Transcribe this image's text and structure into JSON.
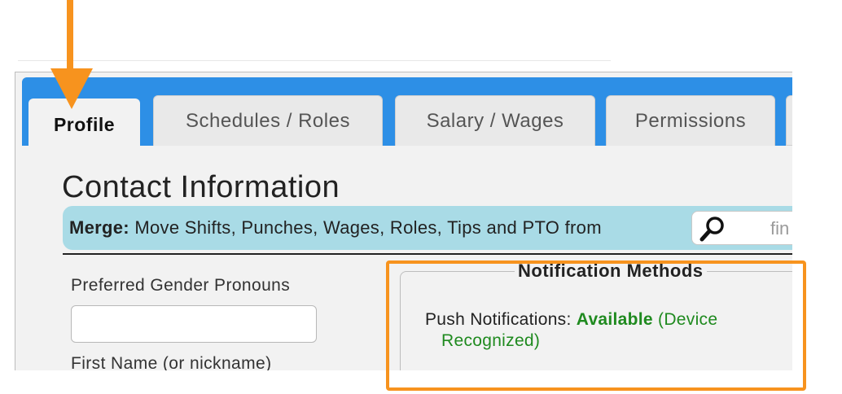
{
  "tabs": [
    {
      "label": "Profile",
      "active": true
    },
    {
      "label": "Schedules / Roles",
      "active": false
    },
    {
      "label": "Salary / Wages",
      "active": false
    },
    {
      "label": "Permissions",
      "active": false
    }
  ],
  "section_title": "Contact Information",
  "merge": {
    "bold_label": "Merge:",
    "text": "Move Shifts, Punches, Wages, Roles, Tips and PTO from",
    "search_placeholder": "fin"
  },
  "fields": {
    "pronouns_label": "Preferred Gender Pronouns",
    "pronouns_value": "",
    "first_name_label": "First Name (or nickname)"
  },
  "notifications": {
    "legend": "Notification Methods",
    "push_label": "Push Notifications:",
    "push_status": "Available",
    "push_detail_1": "(Device",
    "push_detail_2": "Recognized)"
  },
  "colors": {
    "tabbar": "#2d8fe6",
    "merge_bar": "#a9dbe6",
    "available_green": "#1f8a1f",
    "annotation_orange": "#f7931e"
  },
  "icons": [
    "search-icon",
    "annotation-arrow-icon"
  ]
}
